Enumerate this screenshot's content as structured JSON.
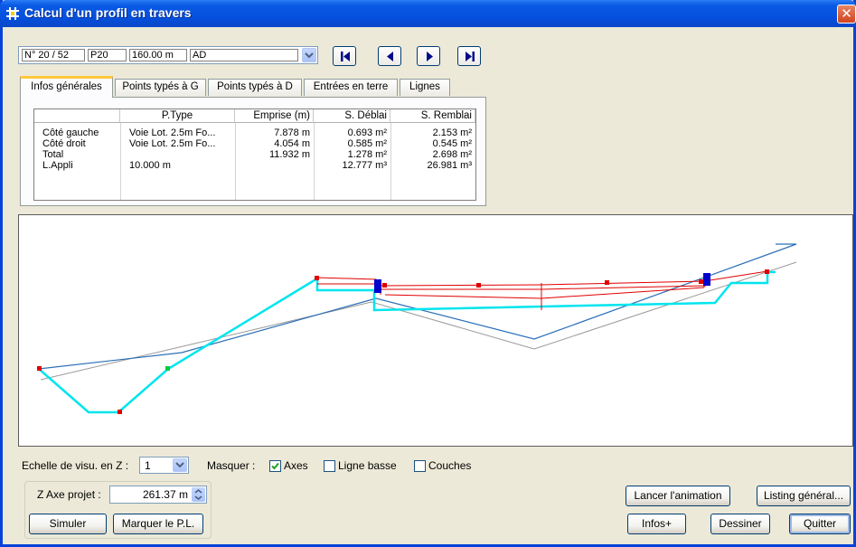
{
  "window": {
    "title": "Calcul d'un profil en travers",
    "close_glyph": "✕",
    "title_icon": "grid-icon"
  },
  "profile_selector": {
    "fields": [
      "N° 20 / 52",
      "P20",
      "160.00 m",
      "AD"
    ],
    "nav_icons": [
      "first-icon",
      "previous-icon",
      "next-icon",
      "last-icon"
    ]
  },
  "tabs": [
    {
      "label": "Infos générales",
      "active": true
    },
    {
      "label": "Points typés à G",
      "active": false
    },
    {
      "label": "Points typés à D",
      "active": false
    },
    {
      "label": "Entrées en terre",
      "active": false
    },
    {
      "label": "Lignes",
      "active": false
    }
  ],
  "table": {
    "headers": [
      "",
      "P.Type",
      "Emprise (m)",
      "S. Déblai",
      "S. Remblai"
    ],
    "rows": [
      [
        "Côté gauche",
        "Voie Lot. 2.5m Fo...",
        "7.878 m",
        "0.693 m²",
        "2.153 m²"
      ],
      [
        "Côté droit",
        "Voie Lot. 2.5m Fo...",
        "4.054 m",
        "0.585 m²",
        "0.545 m²"
      ],
      [
        "Total",
        "",
        "11.932 m",
        "1.278 m²",
        "2.698 m²"
      ],
      [
        "L.Appli",
        "10.000 m",
        "",
        "12.777 m³",
        "26.981 m³"
      ]
    ]
  },
  "controls": {
    "scale_label": "Echelle de visu. en Z :",
    "scale_value": "1",
    "mask_label": "Masquer :",
    "checkboxes": [
      {
        "label": "Axes",
        "checked": true
      },
      {
        "label": "Ligne basse",
        "checked": false
      },
      {
        "label": "Couches",
        "checked": false
      }
    ],
    "z_label": "Z Axe projet :",
    "z_value": "261.37 m"
  },
  "buttons": {
    "simuler": "Simuler",
    "marquer": "Marquer le P.L.",
    "animation": "Lancer l'animation",
    "listing": "Listing général...",
    "infos": "Infos+",
    "dessiner": "Dessiner",
    "quitter": "Quitter"
  },
  "colors": {
    "terrain_line": "#00e5ee",
    "project_line": "#e00000",
    "blue_line": "#2b6fb8",
    "grey_line": "#9a9a9a",
    "accent": "#0842d8"
  }
}
